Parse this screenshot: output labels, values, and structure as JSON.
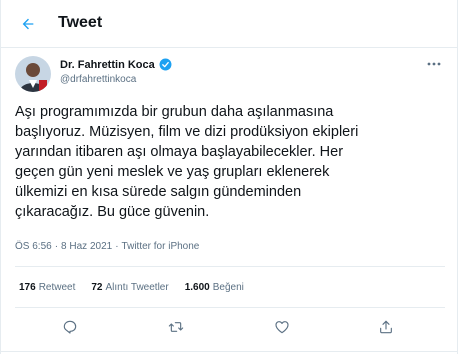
{
  "header": {
    "title": "Tweet"
  },
  "author": {
    "name": "Dr. Fahrettin Koca",
    "handle": "@drfahrettinkoca"
  },
  "tweet": {
    "text": "Aşı programımızda bir grubun daha aşılanmasına\nbaşlıyoruz. Müzisyen, film ve dizi prodüksiyon ekipleri\nyarından itibaren aşı olmaya başlayabilecekler. Her\ngeçen gün yeni meslek ve yaş grupları eklenerek\nülkemizi en kısa sürede salgın gündeminden\nçıkaracağız. Bu güce güvenin.",
    "time": "ÖS 6:56",
    "sep": "·",
    "date": "8 Haz 2021",
    "source": "Twitter for iPhone"
  },
  "stats": {
    "retweets_count": "176",
    "retweets_label": "Retweet",
    "quotes_count": "72",
    "quotes_label": "Alıntı Tweetler",
    "likes_count": "1.600",
    "likes_label": "Beğeni"
  },
  "icons": {
    "back": "arrow-left-icon",
    "verified": "verified-badge-icon",
    "more": "more-horizontal-icon",
    "reply": "reply-icon",
    "retweet": "retweet-icon",
    "like": "heart-icon",
    "share": "share-icon"
  },
  "colors": {
    "accent": "#1da1f2",
    "secondary_text": "#5b7083",
    "primary_text": "#0f1419",
    "border": "#e6ecf0"
  }
}
